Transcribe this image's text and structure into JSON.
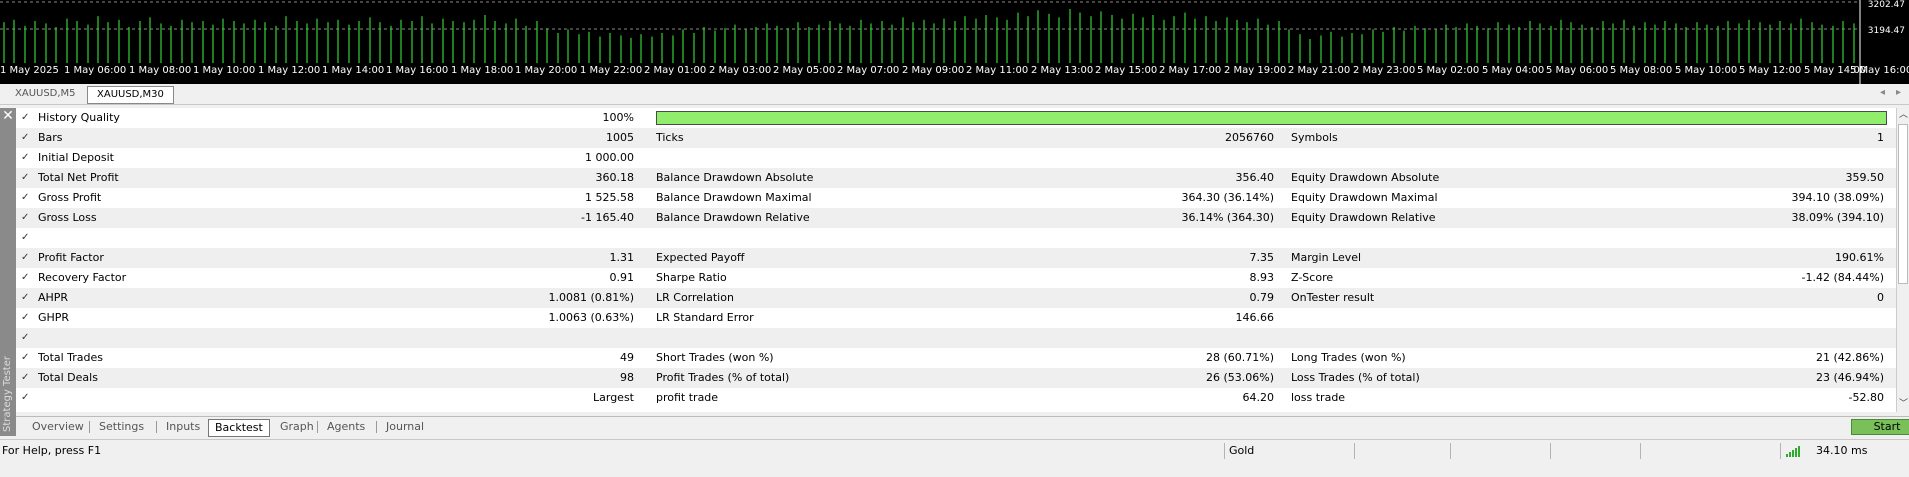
{
  "chart": {
    "time_labels": [
      "1 May 2025",
      "1 May 06:00",
      "1 May 08:00",
      "1 May 10:00",
      "1 May 12:00",
      "1 May 14:00",
      "1 May 16:00",
      "1 May 18:00",
      "1 May 20:00",
      "1 May 22:00",
      "2 May 01:00",
      "2 May 03:00",
      "2 May 05:00",
      "2 May 07:00",
      "2 May 09:00",
      "2 May 11:00",
      "2 May 13:00",
      "2 May 15:00",
      "2 May 17:00",
      "2 May 19:00",
      "2 May 21:00",
      "2 May 23:00",
      "5 May 02:00",
      "5 May 04:00",
      "5 May 06:00",
      "5 May 08:00",
      "5 May 10:00",
      "5 May 12:00",
      "5 May 14:00",
      "5 May 16:00"
    ],
    "price_top": "3202.47",
    "price_mid": "3194.47",
    "bar_color": "#32d232",
    "tick_volumes": [
      0.68,
      0.72,
      0.62,
      0.7,
      0.66,
      0.6,
      0.74,
      0.7,
      0.64,
      0.78,
      0.68,
      0.72,
      0.6,
      0.7,
      0.76,
      0.66,
      0.62,
      0.72,
      0.68,
      0.7,
      0.64,
      0.74,
      0.7,
      0.66,
      0.72,
      0.68,
      0.62,
      0.78,
      0.7,
      0.66,
      0.74,
      0.68,
      0.72,
      0.64,
      0.7,
      0.76,
      0.68,
      0.62,
      0.72,
      0.7,
      0.78,
      0.66,
      0.74,
      0.7,
      0.68,
      0.72,
      0.8,
      0.7,
      0.66,
      0.74,
      0.62,
      0.7,
      0.58,
      0.5,
      0.56,
      0.48,
      0.52,
      0.44,
      0.5,
      0.46,
      0.42,
      0.48,
      0.44,
      0.5,
      0.46,
      0.56,
      0.5,
      0.6,
      0.54,
      0.58,
      0.64,
      0.56,
      0.6,
      0.66,
      0.62,
      0.58,
      0.68,
      0.6,
      0.64,
      0.7,
      0.66,
      0.62,
      0.72,
      0.66,
      0.7,
      0.64,
      0.76,
      0.68,
      0.72,
      0.66,
      0.74,
      0.7,
      0.78,
      0.74,
      0.8,
      0.76,
      0.72,
      0.84,
      0.78,
      0.88,
      0.82,
      0.76,
      0.9,
      0.84,
      0.78,
      0.86,
      0.8,
      0.74,
      0.82,
      0.76,
      0.8,
      0.72,
      0.78,
      0.84,
      0.74,
      0.78,
      0.7,
      0.76,
      0.72,
      0.68,
      0.74,
      0.64,
      0.7,
      0.56,
      0.48,
      0.4,
      0.46,
      0.52,
      0.44,
      0.5,
      0.48,
      0.56,
      0.52,
      0.6,
      0.54,
      0.62,
      0.58,
      0.56,
      0.64,
      0.6,
      0.66,
      0.62,
      0.58,
      0.68,
      0.64,
      0.6,
      0.7,
      0.66,
      0.62,
      0.72,
      0.68,
      0.64,
      0.6,
      0.7,
      0.66,
      0.72,
      0.62,
      0.68,
      0.64,
      0.7,
      0.66,
      0.6,
      0.68,
      0.64,
      0.62,
      0.7,
      0.66,
      0.72,
      0.68,
      0.64,
      0.7,
      0.66,
      0.74,
      0.68,
      0.64,
      0.62,
      0.7,
      0.66
    ]
  },
  "symbol_tabs": [
    "XAUUSD,M5",
    "XAUUSD,M30"
  ],
  "panel_vertical_label": "Strategy Tester",
  "results": {
    "history_quality": {
      "label": "History Quality",
      "value": "100%",
      "progress": 1.0
    },
    "rows": [
      {
        "c1": "Bars",
        "v1": "1005",
        "c2": "Ticks",
        "v2": "2056760",
        "c3": "Symbols",
        "v3": "1"
      },
      {
        "c1": "Initial Deposit",
        "v1": "1 000.00",
        "c2": "",
        "v2": "",
        "c3": "",
        "v3": ""
      },
      {
        "c1": "Total Net Profit",
        "v1": "360.18",
        "c2": "Balance Drawdown Absolute",
        "v2": "356.40",
        "c3": "Equity Drawdown Absolute",
        "v3": "359.50"
      },
      {
        "c1": "Gross Profit",
        "v1": "1 525.58",
        "c2": "Balance Drawdown Maximal",
        "v2": "364.30 (36.14%)",
        "c3": "Equity Drawdown Maximal",
        "v3": "394.10 (38.09%)"
      },
      {
        "c1": "Gross Loss",
        "v1": "-1 165.40",
        "c2": "Balance Drawdown Relative",
        "v2": "36.14% (364.30)",
        "c3": "Equity Drawdown Relative",
        "v3": "38.09% (394.10)"
      },
      {
        "c1": "",
        "v1": "",
        "c2": "",
        "v2": "",
        "c3": "",
        "v3": ""
      },
      {
        "c1": "Profit Factor",
        "v1": "1.31",
        "c2": "Expected Payoff",
        "v2": "7.35",
        "c3": "Margin Level",
        "v3": "190.61%"
      },
      {
        "c1": "Recovery Factor",
        "v1": "0.91",
        "c2": "Sharpe Ratio",
        "v2": "8.93",
        "c3": "Z-Score",
        "v3": "-1.42 (84.44%)"
      },
      {
        "c1": "AHPR",
        "v1": "1.0081 (0.81%)",
        "c2": "LR Correlation",
        "v2": "0.79",
        "c3": "OnTester result",
        "v3": "0"
      },
      {
        "c1": "GHPR",
        "v1": "1.0063 (0.63%)",
        "c2": "LR Standard Error",
        "v2": "146.66",
        "c3": "",
        "v3": ""
      },
      {
        "c1": "",
        "v1": "",
        "c2": "",
        "v2": "",
        "c3": "",
        "v3": ""
      },
      {
        "c1": "Total Trades",
        "v1": "49",
        "c2": "Short Trades (won %)",
        "v2": "28 (60.71%)",
        "c3": "Long Trades (won %)",
        "v3": "21 (42.86%)"
      },
      {
        "c1": "Total Deals",
        "v1": "98",
        "c2": "Profit Trades (% of total)",
        "v2": "26 (53.06%)",
        "c3": "Loss Trades (% of total)",
        "v3": "23 (46.94%)"
      },
      {
        "c1": "",
        "v1": "Largest",
        "c2": "profit trade",
        "v2": "64.20",
        "c3": "loss trade",
        "v3": "-52.80"
      }
    ]
  },
  "bottom_tabs": [
    "Overview",
    "Settings",
    "Inputs",
    "Backtest",
    "Graph",
    "Agents",
    "Journal"
  ],
  "active_bottom_tab": "Backtest",
  "start_label": "Start",
  "status": {
    "help": "For Help, press F1",
    "profile": "Gold",
    "ping": "34.10 ms"
  },
  "colors": {
    "progress": "#90ee6c",
    "start_button": "#79c05a",
    "signal": "#2eaa2e"
  }
}
